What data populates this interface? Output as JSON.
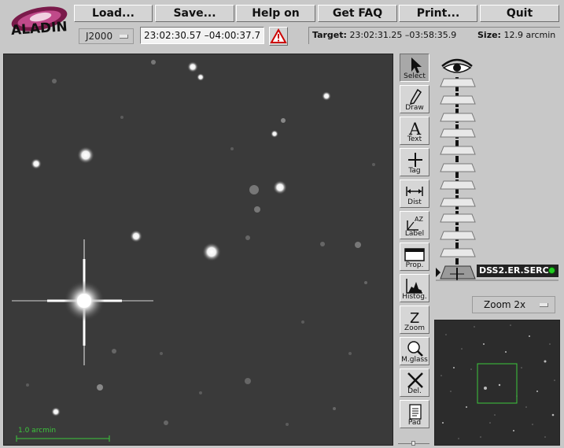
{
  "app": {
    "logo_text": "ALADIN"
  },
  "toolbar": {
    "buttons": [
      "Load...",
      "Save...",
      "Help on",
      "Get FAQ",
      "Print...",
      "Quit"
    ]
  },
  "position": {
    "frame": "J2000",
    "coordinates": "23:02:30.57 –04:00:37.7"
  },
  "info": {
    "target_label": "Target:",
    "target_value": "23:02:31.25 –03:58:35.9",
    "size_label": "Size:",
    "size_value": "12.9 arcmin"
  },
  "view": {
    "scale_label": "1.0 arcmin",
    "scale_color": "#3cc83c"
  },
  "tools": [
    {
      "name": "select",
      "label": "Select",
      "icon": "arrow-pointer-icon",
      "active": true
    },
    {
      "name": "draw",
      "label": "Draw",
      "icon": "pencil-icon",
      "active": false
    },
    {
      "name": "text",
      "label": "Text",
      "icon": "letter-a-icon",
      "active": false
    },
    {
      "name": "tag",
      "label": "Tag",
      "icon": "plus-cross-icon",
      "active": false
    },
    {
      "name": "dist",
      "label": "Dist",
      "icon": "double-arrow-icon",
      "active": false
    },
    {
      "name": "label",
      "label": "Label",
      "icon": "label-az-icon",
      "active": false
    },
    {
      "name": "prop",
      "label": "Prop.",
      "icon": "window-icon",
      "active": false
    },
    {
      "name": "histog",
      "label": "Histog.",
      "icon": "histogram-icon",
      "active": false
    },
    {
      "name": "zoom",
      "label": "Zoom",
      "icon": "letter-z-icon",
      "active": false
    },
    {
      "name": "mglass",
      "label": "M.glass",
      "icon": "magnifier-icon",
      "active": false
    },
    {
      "name": "del",
      "label": "Del.",
      "icon": "x-cross-icon",
      "active": false
    },
    {
      "name": "pad",
      "label": "Pad",
      "icon": "notepad-icon",
      "active": false
    }
  ],
  "stack": {
    "plane_label": "DSS2.ER.SERC",
    "status_color": "#22cc22"
  },
  "zoom": {
    "value": "Zoom 2x"
  },
  "colors": {
    "panel": "#c8c8c8",
    "view_bg": "#3a3a3a",
    "frame_box": "#3cc83c",
    "warning": "#cc0000"
  }
}
